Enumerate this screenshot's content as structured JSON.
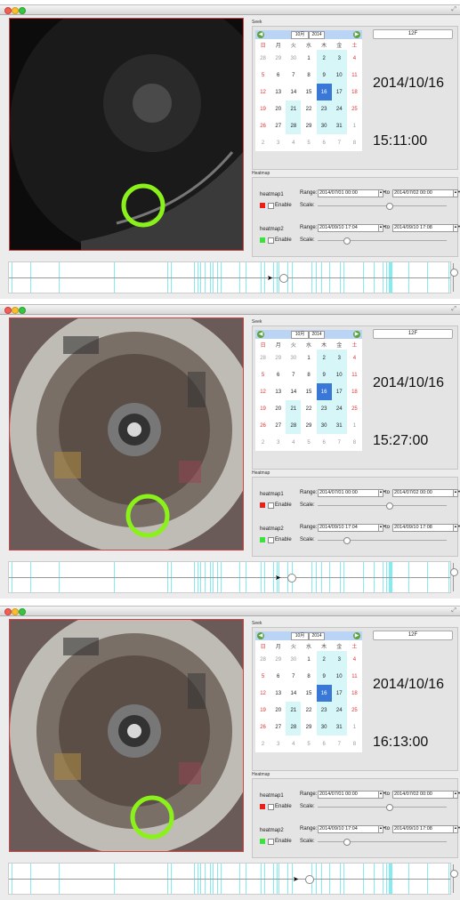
{
  "app": {
    "zoom_icon": "expand-icon"
  },
  "calendar": {
    "month": "10月",
    "year": "2014",
    "weekdays": [
      "日",
      "月",
      "火",
      "水",
      "木",
      "金",
      "土"
    ],
    "weeks": [
      [
        "28",
        "29",
        "30",
        "1",
        "2",
        "3",
        "4"
      ],
      [
        "5",
        "6",
        "7",
        "8",
        "9",
        "10",
        "11"
      ],
      [
        "12",
        "13",
        "14",
        "15",
        "16",
        "17",
        "18"
      ],
      [
        "19",
        "20",
        "21",
        "22",
        "23",
        "24",
        "25"
      ],
      [
        "26",
        "27",
        "28",
        "29",
        "30",
        "31",
        "1"
      ],
      [
        "2",
        "3",
        "4",
        "5",
        "6",
        "7",
        "8"
      ]
    ],
    "selected": "16"
  },
  "colors": {
    "heatmap1": "#e8201a",
    "heatmap2": "#3be23b",
    "marker": "#8af11a",
    "timeline_mark": "#58e6ee",
    "selected_day": "#3a78d8"
  },
  "panels": [
    {
      "seek_label": "Seek",
      "floor_button": "12F",
      "date": "2014/10/16",
      "time": "15:11:00",
      "heatmap_label": "Heatmap",
      "heatmaps": [
        {
          "name": "heatmap1",
          "range_label": "Range:",
          "from": "2014/07/01 00:00",
          "to_label": "to",
          "to": "2014/07/02 00:00",
          "enable_label": "Enable",
          "scale_label": "Scale:",
          "scale_value": 0.55
        },
        {
          "name": "heatmap2",
          "range_label": "Range:",
          "from": "2014/09/10 17:04",
          "to_label": "to",
          "to": "2014/09/10 17:08",
          "enable_label": "Enable",
          "scale_label": "Scale:",
          "scale_value": 0.22
        }
      ],
      "timeline_position": 0.62,
      "scene": "dark"
    },
    {
      "seek_label": "Seek",
      "floor_button": "12F",
      "date": "2014/10/16",
      "time": "15:27:00",
      "heatmap_label": "Heatmap",
      "heatmaps": [
        {
          "name": "heatmap1",
          "range_label": "Range:",
          "from": "2014/07/01 00:00",
          "to_label": "to",
          "to": "2014/07/02 00:00",
          "enable_label": "Enable",
          "scale_label": "Scale:",
          "scale_value": 0.55
        },
        {
          "name": "heatmap2",
          "range_label": "Range:",
          "from": "2014/09/10 17:04",
          "to_label": "to",
          "to": "2014/09/10 17:08",
          "enable_label": "Enable",
          "scale_label": "Scale:",
          "scale_value": 0.22
        }
      ],
      "timeline_position": 0.64,
      "scene": "lit"
    },
    {
      "seek_label": "Seek",
      "floor_button": "12F",
      "date": "2014/10/16",
      "time": "16:13:00",
      "heatmap_label": "Heatmap",
      "heatmaps": [
        {
          "name": "heatmap1",
          "range_label": "Range:",
          "from": "2014/07/01 00:00",
          "to_label": "to",
          "to": "2014/07/02 00:00",
          "enable_label": "Enable",
          "scale_label": "Scale:",
          "scale_value": 0.55
        },
        {
          "name": "heatmap2",
          "range_label": "Range:",
          "from": "2014/09/10 17:04",
          "to_label": "to",
          "to": "2014/09/10 17:08",
          "enable_label": "Enable",
          "scale_label": "Scale:",
          "scale_value": 0.22
        }
      ],
      "timeline_position": 0.68,
      "scene": "lit"
    }
  ]
}
